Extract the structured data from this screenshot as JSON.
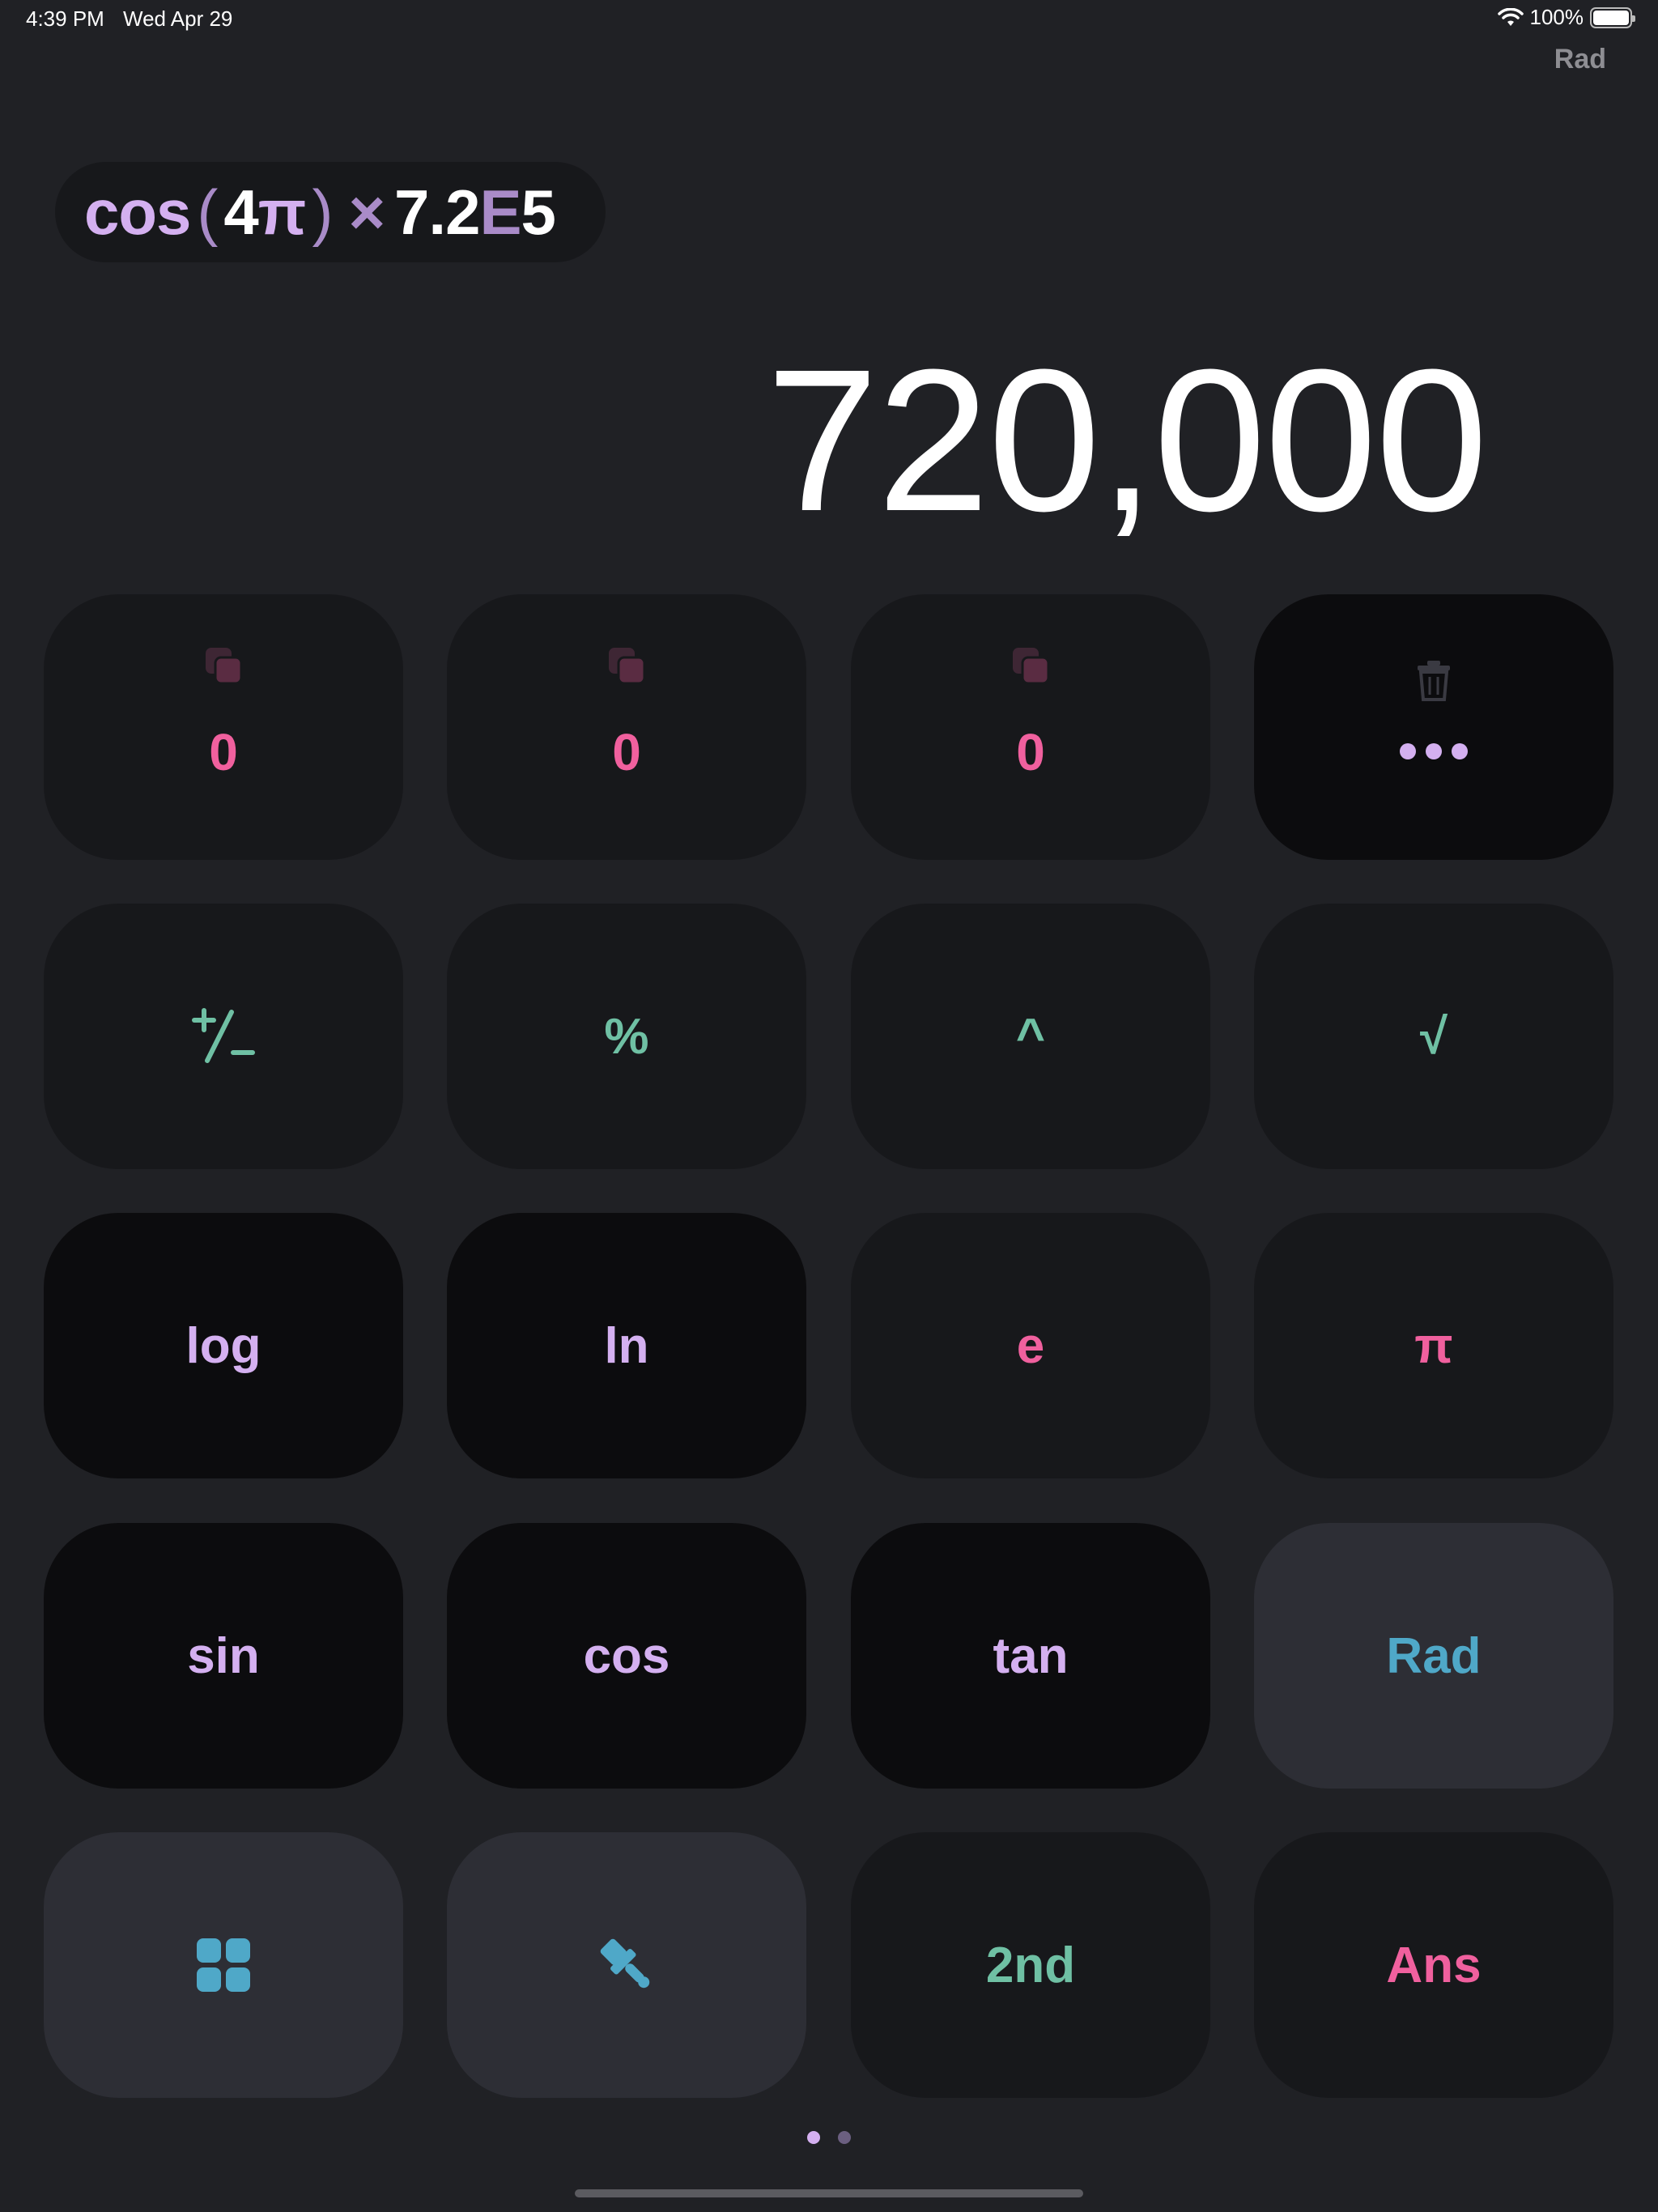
{
  "status_bar": {
    "time": "4:39 PM",
    "date": "Wed Apr 29",
    "battery": "100%",
    "icons": [
      "wifi-icon",
      "battery-icon"
    ]
  },
  "header": {
    "mode": "Rad"
  },
  "expression": {
    "fn": "cos",
    "open": "(",
    "arg_num": "4",
    "arg_pi": "π",
    "close": ")",
    "op": "×",
    "mantissa": "7.2",
    "exp_sym": "E",
    "exponent": "5"
  },
  "result": "720,000",
  "memory": [
    {
      "value": "0",
      "icon": "copy-icon"
    },
    {
      "value": "0",
      "icon": "copy-icon"
    },
    {
      "value": "0",
      "icon": "copy-icon"
    }
  ],
  "memory_more": {
    "icon": "trash-icon",
    "dots": "more-icon"
  },
  "keys": {
    "plus_minus": "+/−",
    "percent": "%",
    "power": "^",
    "sqrt": "√",
    "log": "log",
    "ln": "ln",
    "e": "e",
    "pi": "π",
    "sin": "sin",
    "cos": "cos",
    "tan": "tan",
    "rad": "Rad",
    "grid": "grid-icon",
    "theme": "paintbrush-icon",
    "second": "2nd",
    "ans": "Ans"
  },
  "colors": {
    "background": "#202125",
    "pink": "#f0609e",
    "green": "#6fc0a4",
    "purple": "#d4b0f0",
    "blue": "#4fa8c8"
  },
  "pagination": {
    "current": 1,
    "total": 2
  }
}
